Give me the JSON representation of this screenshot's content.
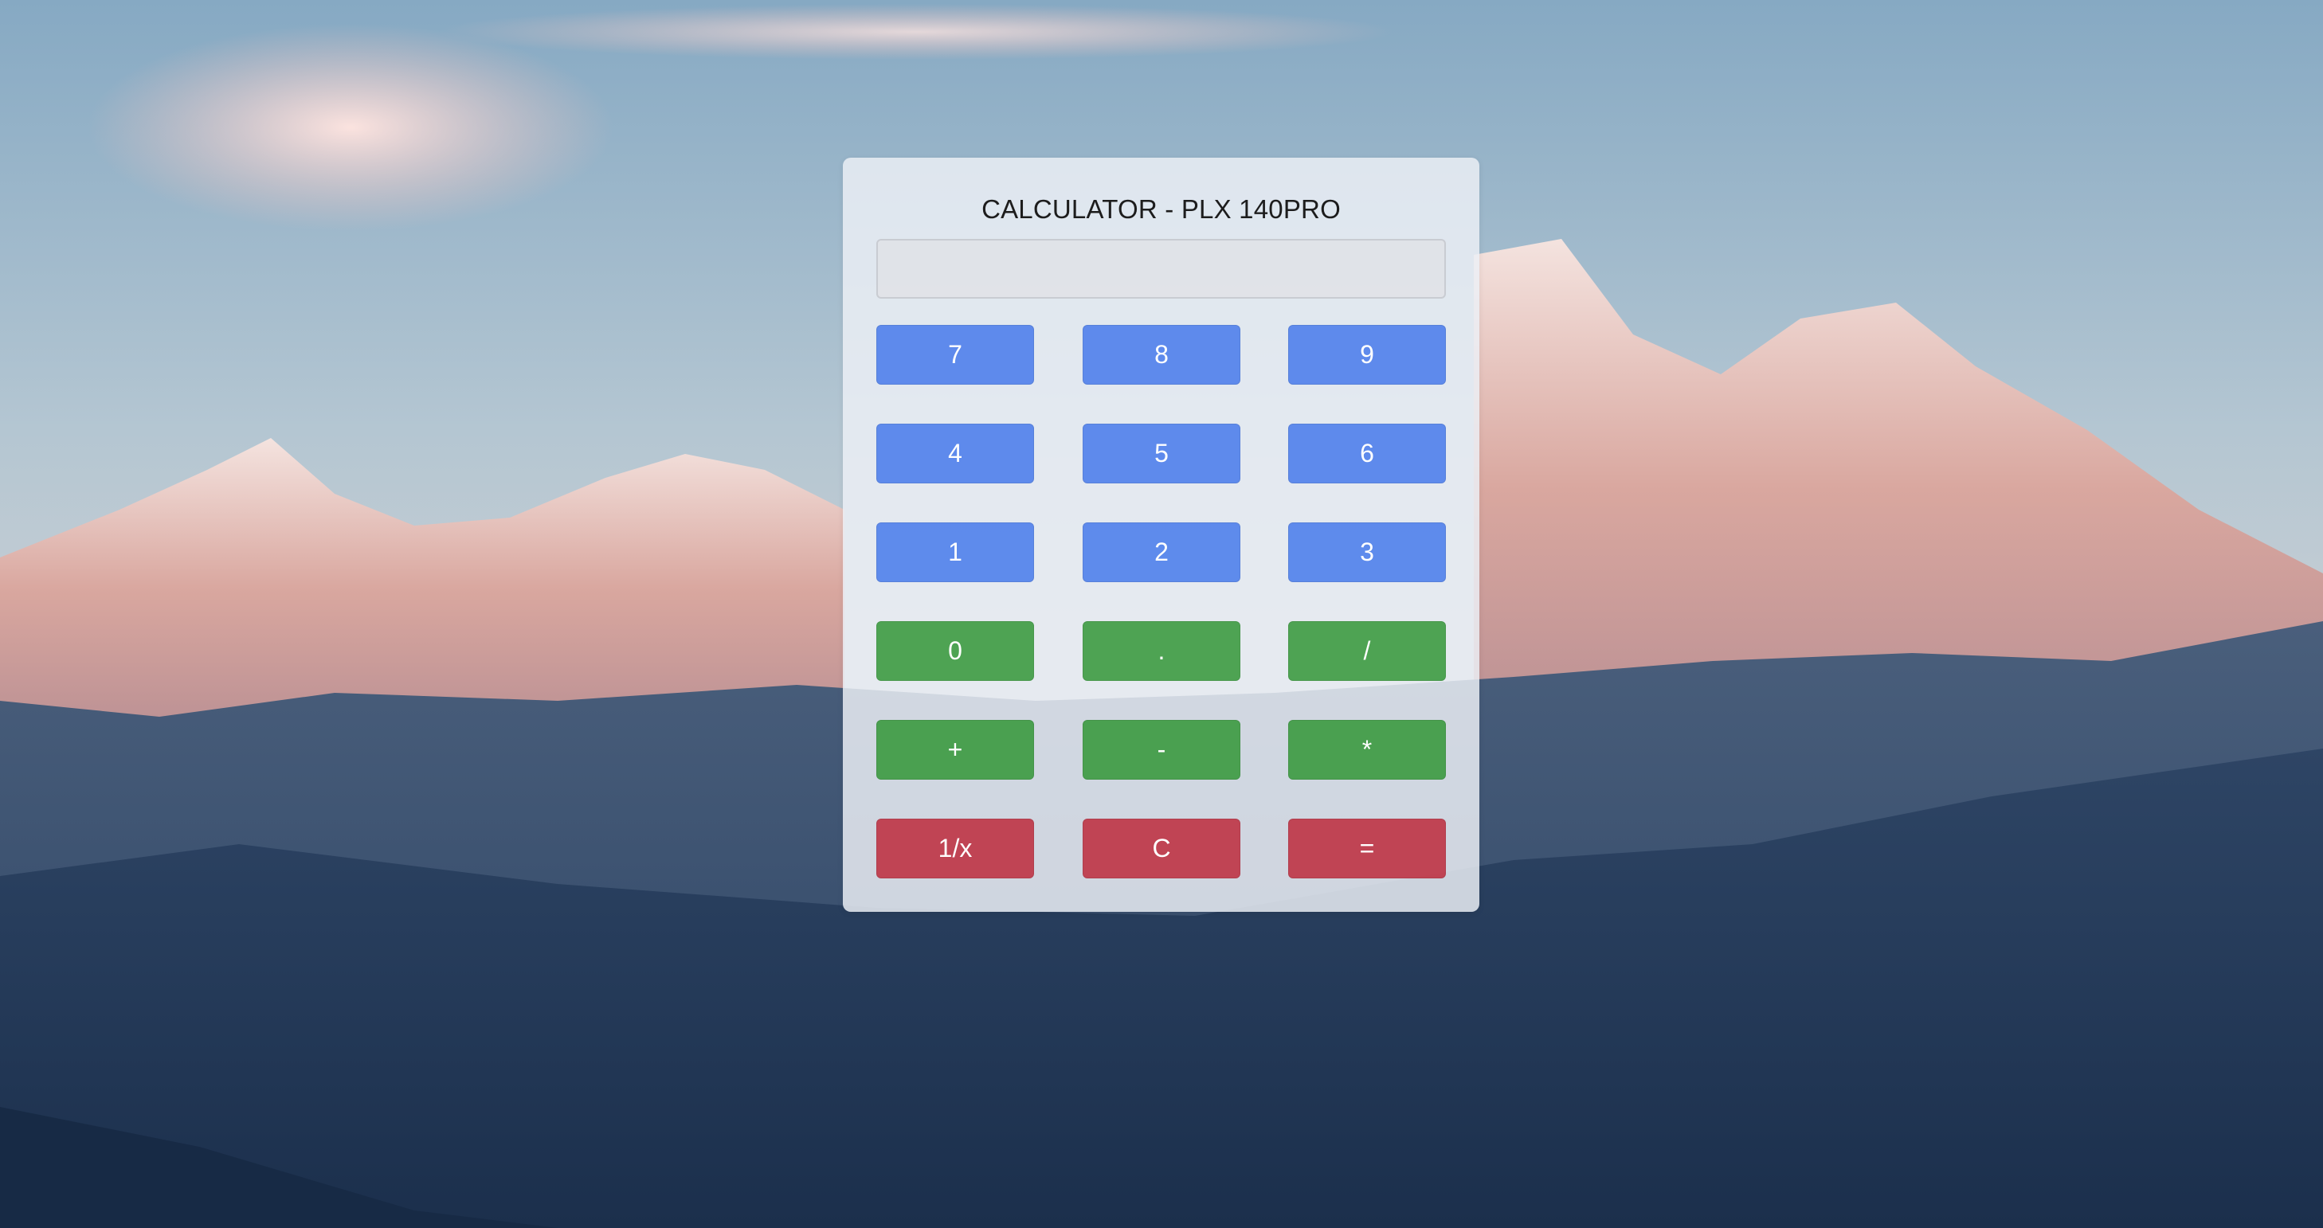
{
  "calculator": {
    "title": "CALCULATOR - PLX 140PRO",
    "display_value": "",
    "keys": {
      "seven": "7",
      "eight": "8",
      "nine": "9",
      "four": "4",
      "five": "5",
      "six": "6",
      "one": "1",
      "two": "2",
      "three": "3",
      "zero": "0",
      "decimal": ".",
      "divide": "/",
      "plus": "+",
      "minus": "-",
      "multiply": "*",
      "reciprocal": "1/x",
      "clear": "C",
      "equals": "="
    }
  },
  "colors": {
    "number_key": "#3870eb",
    "operator_key": "#2c9430",
    "function_key": "#bc2334",
    "panel": "#ecf0f5"
  }
}
